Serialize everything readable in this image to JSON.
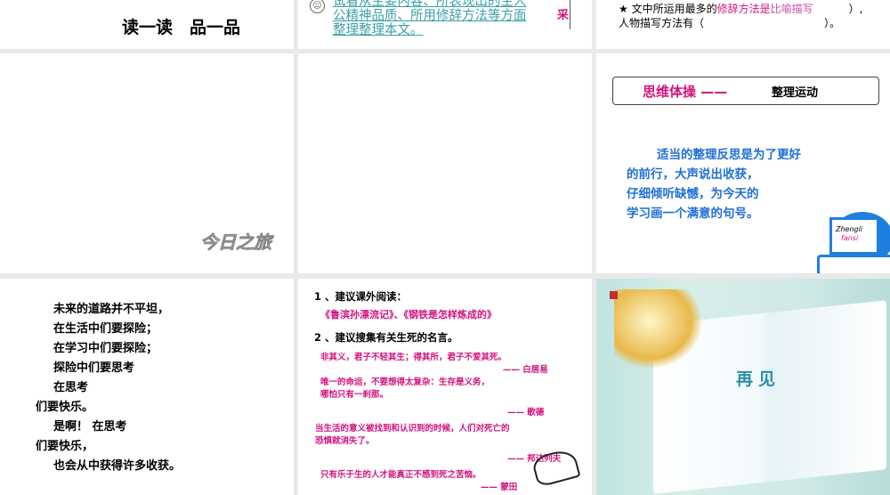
{
  "slides": [
    {
      "title": "读一读　品一品"
    },
    {
      "icon": "smiley-icon",
      "lines": [
        "试看从主要内容、所表现出的主人",
        "公精神品质、所用修辞方法等方面",
        "整理整理本文。"
      ],
      "side_char": "采"
    },
    {
      "line1_a": "★ 文中所运用最多的",
      "line1_b": "修辞方法是",
      "line1_c": "比喻描写",
      "line1_d": "）,",
      "line2": "人物描写方法有（",
      "line2_end": "）。"
    },
    {
      "watermark": "今日之旅"
    },
    {},
    {
      "banner_a": "思维体操 ——",
      "banner_b": "整理运动",
      "lines": [
        "适当的整理反思是为了更好",
        "的前行，大声说出收获，",
        "仔细倾听缺憾，为今天的",
        "学习画一个满意的句号。"
      ],
      "logo_line1": "Zhengli",
      "logo_line2": "fansi"
    },
    {
      "lines": [
        "未来的道路并不平坦，",
        "在生活中们要探险；",
        "在学习中们要探险；",
        "探险中们要思考",
        "在思考",
        "们要快乐。",
        "是啊！ 在思考",
        "们要快乐，",
        "也会从中获得许多收获。"
      ]
    },
    {
      "h1": "1 、建议课外阅读：",
      "books": "《鲁滨孙漂流记》、《钢铁是怎样炼成的》",
      "h2": "2 、建议搜集有关生死的名言。",
      "quotes": [
        {
          "text": [
            "非其义，君子不轻其生；得其所，君子不爱其死。"
          ],
          "author": "—— 白居易"
        },
        {
          "text": [
            "唯一的命运，不要想得太复杂：生存是义务，",
            "哪怕只有一刹那。"
          ],
          "author": "—— 歌德"
        },
        {
          "text": [
            "当生活的意义被找到和认识到的时候，人们对死亡的",
            "恐惧就消失了。"
          ],
          "author": "—— 邦达列夫"
        },
        {
          "text": [
            "只有乐于生的人才能真正不感到死之苦恼。"
          ],
          "author": "—— 蒙田"
        }
      ]
    },
    {
      "title": "再见"
    }
  ]
}
